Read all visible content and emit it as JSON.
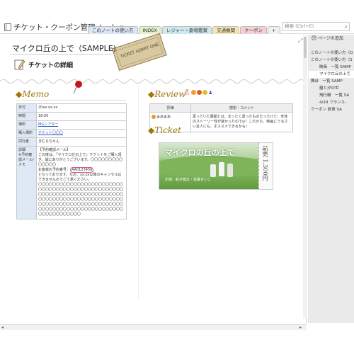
{
  "notebook": {
    "title": "チケット・クーポン管理ノート"
  },
  "tabs": [
    {
      "label": "このノートの使い方",
      "color": "#dbe5f3"
    },
    {
      "label": "INDEX",
      "color": "#e3efc9"
    },
    {
      "label": "レジャー・劇場鑑賞",
      "color": "#cde9ef"
    },
    {
      "label": "交通機関",
      "color": "#f6e5b3"
    },
    {
      "label": "クーポン",
      "color": "#f5cfd4"
    },
    {
      "label": "+",
      "color": "#f0f0f0"
    }
  ],
  "search": {
    "placeholder": "検索 (Ctrl+E)"
  },
  "page": {
    "title": "マイクロ丘の上で（SAMPLE)",
    "subtitle": "チケットの詳細",
    "ticket_stamp": "TICKET ADMIT ONE"
  },
  "memo": {
    "heading": "Memo",
    "rows": [
      {
        "label": "日付",
        "value": "20xx.xx.xx",
        "link": false
      },
      {
        "label": "時間",
        "value": "18:00",
        "link": false
      },
      {
        "label": "場所",
        "value": "MGシアター",
        "link": true
      },
      {
        "label": "購入場所",
        "value": "チケット〇〇〇",
        "link": true
      },
      {
        "label": "同行者",
        "value": "きむらちゃん",
        "link": false
      }
    ],
    "detail_label": "詳細",
    "mail_label": "※予約確認メール/ メモ",
    "mail_lines": [
      "【予約確認メール】",
      "この度は、「マイクロ丘の上で」チケットをご購入頂き、誠にありがとうございます。〇〇〇〇〇〇〇〇〇〇〇〇〇〇",
      "お客様の予約番号：",
      "AA0123456",
      "となっております。なお、xx.xx以降のキャンセルはできませんのでご了承ください。",
      "〇〇〇〇〇〇〇〇〇〇〇〇〇〇〇〇〇〇〇〇〇〇〇〇〇〇〇〇〇〇〇〇〇〇〇〇〇〇〇〇〇〇〇〇〇〇〇〇〇〇〇〇〇〇〇〇〇〇〇〇〇〇〇〇〇〇〇〇〇〇〇〇〇〇〇〇〇〇〇〇〇〇〇〇〇〇〇〇〇〇〇〇〇〇〇〇〇〇〇〇〇〇〇〇〇〇〇〇〇〇〇〇〇〇〇〇〇〇〇〇〇〇〇〇〇〇〇〇〇〇〇〇〇〇〇〇〇〇〇〇〇〇〇〇〇〇〇〇〇〇〇〇〇〇〇〇"
    ]
  },
  "review": {
    "heading": "Review",
    "col_rating": "評価",
    "col_comment": "感想・コメント",
    "rating": "まあまあ",
    "comment": "思っていた展開とは、まったく違ったものだったけど、全体のストーリー性が良かったので◎！これから、映画にうるさい友人にも、オススメできるかも！"
  },
  "ticket": {
    "heading": "Ticket",
    "movie_title": "マイクロの丘の上で",
    "cast_line": "出演：鈴木健太・佐藤まいこ",
    "price": "前売 1,300円"
  },
  "sidebar": {
    "add_page": "ページの追加",
    "pages": [
      {
        "label": "このノートの使い方（O",
        "sub": false,
        "selected": false
      },
      {
        "label": "このノートの使い方（S",
        "sub": false,
        "selected": false
      },
      {
        "label": "映画　一覧 SAMP",
        "sub": true,
        "selected": false
      },
      {
        "label": "マイクロ丘の上で",
        "sub": true,
        "selected": true
      },
      {
        "label": "舞台　一覧 SAMP",
        "sub": false,
        "selected": false
      },
      {
        "label": "醤と汐の世",
        "sub": true,
        "selected": false
      },
      {
        "label": "飛行機　一覧 SA",
        "sub": true,
        "selected": false
      },
      {
        "label": "4/29 フランス-",
        "sub": true,
        "selected": false
      },
      {
        "label": "クーポン 飲食 SA",
        "sub": false,
        "selected": false
      }
    ]
  },
  "colors": {
    "accent": "#a0780a",
    "link": "#2453b5",
    "label_bg": "#dfe9f5"
  }
}
